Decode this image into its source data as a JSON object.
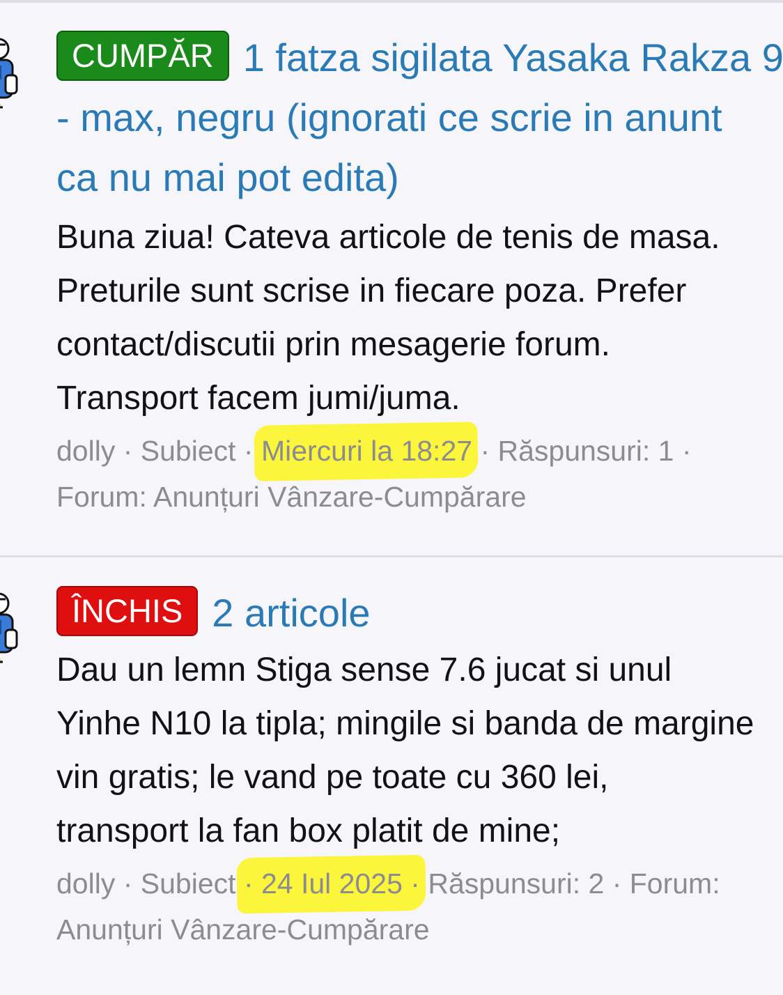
{
  "posts": [
    {
      "badge": "CUMPĂR",
      "badge_color": "#1a8a1a",
      "title_lines": [
        "1 fatza sigilata Yasaka Rakza 9",
        "- max, negru (ignorati ce scrie in anunt",
        "ca nu mai pot edita)"
      ],
      "excerpt_lines": [
        "Buna ziua! Cateva articole de tenis de masa.",
        "Preturile sunt scrise in fiecare poza. Prefer",
        "contact/discutii prin mesagerie forum.",
        "Transport facem jumi/juma."
      ],
      "meta": {
        "author": "dolly",
        "sep1": " · ",
        "type": "Subiect",
        "sep2": " · ",
        "date": "Miercuri la 18:27",
        "sep3": " · ",
        "replies": "Răspunsuri: 1 ·",
        "forum": "Forum: Anunțuri Vânzare-Cumpărare"
      }
    },
    {
      "badge": "ÎNCHIS",
      "badge_color": "#e00f0f",
      "title_lines": [
        "2 articole"
      ],
      "excerpt_lines": [
        "Dau un lemn Stiga sense 7.6 jucat si unul",
        "Yinhe N10 la tipla; mingile si banda de margine",
        "vin gratis; le vand pe toate cu 360 lei,",
        "transport la fan box platit de mine;"
      ],
      "meta": {
        "author": "dolly",
        "sep1": " · ",
        "type": "Subiect",
        "sep2": " ",
        "date": "· 24 Iul 2025 ·",
        "sep3": " ",
        "replies": "Răspunsuri: 2 · Forum:",
        "forum": "Anunțuri Vânzare-Cumpărare"
      }
    }
  ]
}
